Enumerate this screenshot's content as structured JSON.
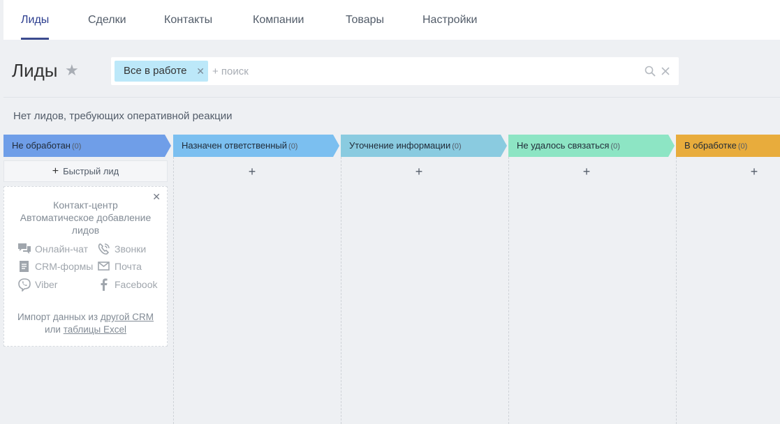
{
  "nav": {
    "tabs": [
      {
        "label": "Лиды"
      },
      {
        "label": "Сделки"
      },
      {
        "label": "Контакты"
      },
      {
        "label": "Компании"
      },
      {
        "label": "Товары"
      },
      {
        "label": "Настройки"
      }
    ],
    "active_index": 0
  },
  "header": {
    "title": "Лиды",
    "filter_chip": "Все в работе",
    "search_placeholder": "+ поиск"
  },
  "notice": "Нет лидов, требующих оперативной реакции",
  "stages": [
    {
      "name": "Не обработан",
      "count": "(0)",
      "color": "#6f9ee8"
    },
    {
      "name": "Назначен ответственный",
      "count": "(0)",
      "color": "#7bbff0"
    },
    {
      "name": "Уточнение информации",
      "count": "(0)",
      "color": "#8acbe0"
    },
    {
      "name": "Не удалось связаться",
      "count": "(0)",
      "color": "#8de5c4"
    },
    {
      "name": "В обработке",
      "count": "(0)",
      "color": "#e8ac3c"
    }
  ],
  "quick_lead_label": "Быстрый лид",
  "add_symbol": "+",
  "card": {
    "title_line1": "Контакт-центр",
    "title_line2": "Автоматическое добавление",
    "title_line3": "лидов",
    "channels": [
      {
        "label": "Онлайн-чат",
        "icon": "chat-icon"
      },
      {
        "label": "Звонки",
        "icon": "phone-icon"
      },
      {
        "label": "CRM-формы",
        "icon": "form-icon"
      },
      {
        "label": "Почта",
        "icon": "mail-icon"
      },
      {
        "label": "Viber",
        "icon": "viber-icon"
      },
      {
        "label": "Facebook",
        "icon": "facebook-icon"
      }
    ],
    "import_prefix": "Импорт данных из",
    "import_link1": "другой CRM",
    "import_or": "или",
    "import_link2": "таблицы Excel"
  }
}
